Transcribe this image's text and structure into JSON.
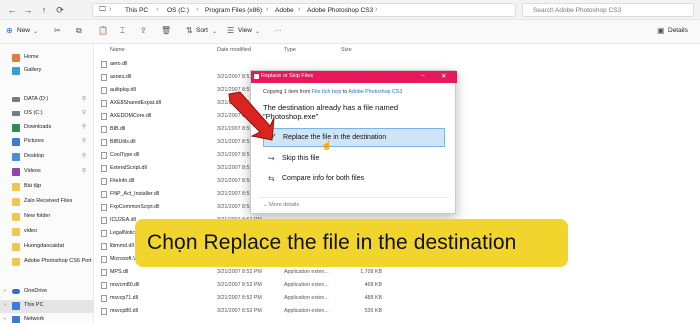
{
  "addressbar": {
    "breadcrumbs": [
      "This PC",
      "OS (C:)",
      "Program Files (x86)",
      "Adobe",
      "Adobe Photoshop CS3"
    ],
    "search_placeholder": "Search Adobe Photoshop CS3"
  },
  "toolbar": {
    "new_label": "New",
    "sort_label": "Sort",
    "view_label": "View",
    "more_label": "···",
    "details_label": "Details"
  },
  "sidebar": {
    "items": [
      {
        "label": "Home",
        "icon": "home-icon",
        "color": "#e07b39"
      },
      {
        "label": "Gallery",
        "icon": "gallery-icon",
        "color": "#3aa0d8"
      },
      {
        "label": "DATA (D:)",
        "icon": "drive-icon",
        "color": "#7a7a7a",
        "pin": "📌"
      },
      {
        "label": "OS (C:)",
        "icon": "drive-icon",
        "color": "#7a7a7a",
        "pin": "📌"
      },
      {
        "label": "Downloads",
        "icon": "download-icon",
        "color": "#2f8c4d",
        "pin": "📌"
      },
      {
        "label": "Pictures",
        "icon": "pictures-icon",
        "color": "#3a7bd5",
        "pin": "📌"
      },
      {
        "label": "Desktop",
        "icon": "desktop-icon",
        "color": "#4a90d9",
        "pin": "📌"
      },
      {
        "label": "Videos",
        "icon": "videos-icon",
        "color": "#8e44ad",
        "pin": "📌"
      },
      {
        "label": "Bài tập",
        "icon": "folder-icon",
        "color": "#f3c74f"
      },
      {
        "label": "Zalo Received Files",
        "icon": "folder-icon",
        "color": "#f3c74f"
      },
      {
        "label": "New folder",
        "icon": "folder-icon",
        "color": "#f3c74f"
      },
      {
        "label": "video",
        "icon": "folder-icon",
        "color": "#f3c74f"
      },
      {
        "label": "Huongdancaidat",
        "icon": "folder-icon",
        "color": "#f3c74f"
      },
      {
        "label": "Adobe Photoshop CS6 Port",
        "icon": "folder-icon",
        "color": "#f3c74f"
      },
      {
        "label": "OneDrive",
        "icon": "cloud-icon",
        "color": "#2a72c9"
      },
      {
        "label": "This PC",
        "icon": "computer-icon",
        "color": "#3a7bd5"
      },
      {
        "label": "Network",
        "icon": "network-icon",
        "color": "#3a7bd5"
      }
    ]
  },
  "columns": {
    "name": "Name",
    "date": "Date modified",
    "type": "Type",
    "size": "Size"
  },
  "files": [
    {
      "name": "aero.dll",
      "date": "",
      "type": "",
      "size": ""
    },
    {
      "name": "asneu.dll",
      "date": "3/21/2007 8:52 PM",
      "type": "Application exten...",
      "size": ""
    },
    {
      "name": "aulitplay.dll",
      "date": "3/21/2007 8:52 PM",
      "type": "",
      "size": ""
    },
    {
      "name": "AXE8SharedExpat.dll",
      "date": "3/21/2007 8:52 PM",
      "type": "",
      "size": ""
    },
    {
      "name": "AXEDOMCore.dll",
      "date": "3/21/2007 8:52 PM",
      "type": "",
      "size": ""
    },
    {
      "name": "BIB.dll",
      "date": "3/21/2007 8:52 PM",
      "type": "",
      "size": ""
    },
    {
      "name": "BIBUtils.dll",
      "date": "3/21/2007 8:52 PM",
      "type": "",
      "size": ""
    },
    {
      "name": "CoolType.dll",
      "date": "3/21/2007 8:52 PM",
      "type": "",
      "size": ""
    },
    {
      "name": "ExtendScript.dll",
      "date": "3/21/2007 8:52 PM",
      "type": "",
      "size": ""
    },
    {
      "name": "FileInfo.dll",
      "date": "3/21/2007 8:52 PM",
      "type": "",
      "size": ""
    },
    {
      "name": "FNP_Act_Installer.dll",
      "date": "3/21/2007 8:52 PM",
      "type": "",
      "size": ""
    },
    {
      "name": "FxpCommonScrpt.dll",
      "date": "3/21/2007 8:52 PM",
      "type": "",
      "size": ""
    },
    {
      "name": "ICU2EA.dll",
      "date": "3/21/2007 8:52 PM",
      "type": "",
      "size": ""
    },
    {
      "name": "LegalNotices",
      "date": "",
      "type": "",
      "size": ""
    },
    {
      "name": "libmmd.dll",
      "date": "",
      "type": "",
      "size": ""
    },
    {
      "name": "Microsoft.VC80",
      "date": "",
      "type": "",
      "size": ""
    },
    {
      "name": "MPS.dll",
      "date": "3/21/2007 8:52 PM",
      "type": "Application exten...",
      "size": "1,709 KB"
    },
    {
      "name": "msvcm80.dll",
      "date": "3/21/2007 8:52 PM",
      "type": "Application exten...",
      "size": "468 KB"
    },
    {
      "name": "msvcp71.dll",
      "date": "3/21/2007 8:52 PM",
      "type": "Application exten...",
      "size": "488 KB"
    },
    {
      "name": "msvcp80.dll",
      "date": "3/21/2007 8:52 PM",
      "type": "Application exten...",
      "size": "536 KB"
    }
  ],
  "dialog": {
    "title": "Replace or Skip Files",
    "copying_prefix": "Copying 1 item from",
    "copying_from": "File tích hợp",
    "copying_to_word": "to",
    "copying_to": "Adobe Photoshop CS3",
    "message": "The destination already has a file named \"Photoshop.exe\"",
    "option_replace": "Replace the file in the destination",
    "option_skip": "Skip this file",
    "option_compare": "Compare info for both files",
    "more_details": "More details"
  },
  "banner": {
    "text": "Chọn Replace the file in the destination"
  },
  "colors": {
    "accent": "#e8195a",
    "banner": "#f1d52c",
    "selection": "#cfe4f7"
  }
}
